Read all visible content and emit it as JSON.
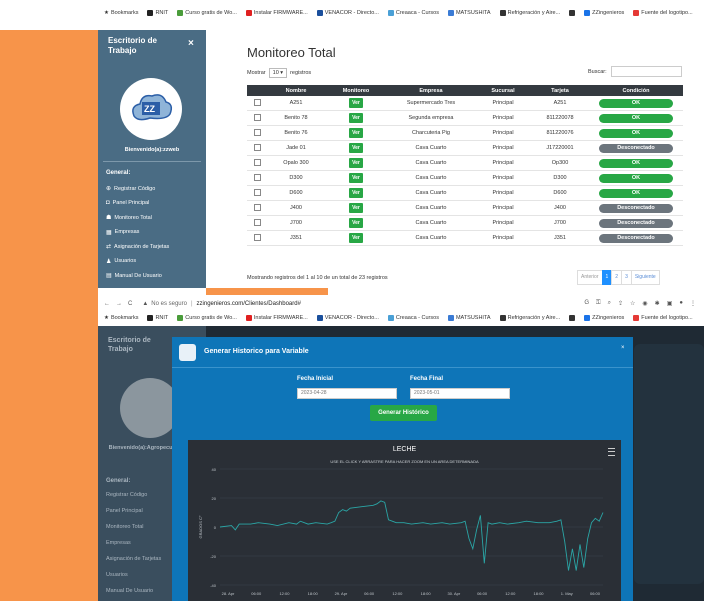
{
  "bookmarks": [
    {
      "label": "Bookmarks",
      "color": "#888888"
    },
    {
      "label": "RNIT",
      "color": "#222222"
    },
    {
      "label": "Curso gratis de Wo...",
      "color": "#4a9c3a"
    },
    {
      "label": "Instalar FIRMWARE...",
      "color": "#e02020"
    },
    {
      "label": "VENACOR - Directo...",
      "color": "#1a4f9c"
    },
    {
      "label": "Creaaca - Cursos",
      "color": "#4aa0d6"
    },
    {
      "label": "MATSUSHITA",
      "color": "#3a7bd5"
    },
    {
      "label": "Refrigeración y Aire...",
      "color": "#333333"
    },
    {
      "label": "",
      "color": "#333333"
    },
    {
      "label": "ZZingenieros",
      "color": "#1a73e8"
    },
    {
      "label": "Fuente del logotipo...",
      "color": "#e53935"
    }
  ],
  "sidebar": {
    "title": "Escritorio de Trabajo",
    "close": "×",
    "welcome": "Bienvenido(a):zzweb",
    "section": "General:",
    "items": [
      {
        "icon": "⊕",
        "label": "Registrar Código"
      },
      {
        "icon": "◘",
        "label": "Panel Principal"
      },
      {
        "icon": "☗",
        "label": "Monitoreo Total"
      },
      {
        "icon": "▦",
        "label": "Empresas"
      },
      {
        "icon": "⇄",
        "label": "Asignación de Tarjetas"
      },
      {
        "icon": "♟",
        "label": "Usuarios"
      },
      {
        "icon": "▤",
        "label": "Manual De Usuario"
      }
    ]
  },
  "main": {
    "title": "Monitoreo Total",
    "show_label": "Mostrar",
    "show_value": "10",
    "records_label": "registros",
    "search_label": "Buscar:",
    "columns": [
      "",
      "Nombre",
      "Monitoreo",
      "Empresa",
      "Sucursal",
      "Tarjeta",
      "Condición"
    ],
    "ver_label": "Ver",
    "rows": [
      {
        "nombre": "A251",
        "empresa": "Supermercado Tres",
        "sucursal": "Principal",
        "tarjeta": "A251",
        "condicion": "OK",
        "status": "ok"
      },
      {
        "nombre": "Benito 78",
        "empresa": "Segunda empresa",
        "sucursal": "Principal",
        "tarjeta": "811220078",
        "condicion": "OK",
        "status": "ok"
      },
      {
        "nombre": "Benito 76",
        "empresa": "Charcuteria Pig",
        "sucursal": "Principal",
        "tarjeta": "811220076",
        "condicion": "OK",
        "status": "ok"
      },
      {
        "nombre": "Jade 01",
        "empresa": "Cava Cuarto",
        "sucursal": "Principal",
        "tarjeta": "J17220001",
        "condicion": "Desconectado",
        "status": "off"
      },
      {
        "nombre": "Opalo 300",
        "empresa": "Cava Cuarto",
        "sucursal": "Principal",
        "tarjeta": "Op300",
        "condicion": "OK",
        "status": "ok"
      },
      {
        "nombre": "D300",
        "empresa": "Cava Cuarto",
        "sucursal": "Principal",
        "tarjeta": "D300",
        "condicion": "OK",
        "status": "ok"
      },
      {
        "nombre": "D600",
        "empresa": "Cava Cuarto",
        "sucursal": "Principal",
        "tarjeta": "D600",
        "condicion": "OK",
        "status": "ok"
      },
      {
        "nombre": "J400",
        "empresa": "Cava Cuarto",
        "sucursal": "Principal",
        "tarjeta": "J400",
        "condicion": "Desconectado",
        "status": "off"
      },
      {
        "nombre": "J700",
        "empresa": "Cava Cuarto",
        "sucursal": "Principal",
        "tarjeta": "J700",
        "condicion": "Desconectado",
        "status": "off"
      },
      {
        "nombre": "J351",
        "empresa": "Cava Cuarto",
        "sucursal": "Principal",
        "tarjeta": "J351",
        "condicion": "Desconectado",
        "status": "off"
      }
    ],
    "showing": "Mostrando registros del 1 al 10 de un total de 23 registros",
    "pagination": {
      "prev": "Anterior",
      "pages": [
        "1",
        "2",
        "3"
      ],
      "next": "Siguiente"
    }
  },
  "nav": {
    "back": "←",
    "forward": "→",
    "reload": "C",
    "warning": "▲",
    "not_secure": "No es seguro",
    "url": "zzingenieros.com/Clientes/Dashboard#"
  },
  "dashboard_sidebar": {
    "title": "Escritorio de Trabajo",
    "welcome": "Bienvenido(a):Agropecuaria Edis",
    "section": "General:",
    "items": [
      "Registrar Código",
      "Panel Principal",
      "Monitoreo Total",
      "Empresas",
      "Asignación de Tarjetas",
      "Usuarios",
      "Manual De Usuario"
    ]
  },
  "modal": {
    "title": "Generar Historico para Variable",
    "close": "×",
    "start_label": "Fecha Inicial",
    "start_value": "2023-04-28",
    "end_label": "Fecha Final",
    "end_value": "2023-05-01",
    "button": "Generar Histórico"
  },
  "colors": {
    "ok": "#28a745",
    "off": "#6c757d",
    "sidebar": "#4a6c84",
    "modal": "#0e75b8",
    "accent": "#f7944a"
  },
  "chart_data": {
    "type": "line",
    "title": "LECHE",
    "subtitle": "USE EL CLICK Y ARRASTRE PARA HACER ZOOM EN UN AREA DETERMINADA",
    "ylabel": "GRADOS C°",
    "ylim": [
      -40,
      40
    ],
    "yticks": [
      40,
      20,
      0,
      -20,
      -40
    ],
    "xtick_labels": [
      "28. Apr",
      "06:00",
      "12:00",
      "18:00",
      "29. Apr",
      "06:00",
      "12:00",
      "18:00",
      "30. Apr",
      "06:00",
      "12:00",
      "18:00",
      "1. May",
      "06:00"
    ],
    "line_color": "#2aa6a6",
    "series": [
      {
        "x": [
          0,
          3,
          4,
          5,
          8,
          10,
          13,
          15,
          18,
          20,
          21,
          23,
          25,
          28,
          29,
          30,
          31,
          32,
          33,
          34,
          37,
          40,
          41,
          42,
          43,
          44,
          45,
          46,
          48,
          50,
          53,
          55,
          58,
          60,
          63,
          64,
          65,
          66,
          67,
          68,
          69,
          70,
          71,
          73,
          75,
          78,
          80,
          83,
          86,
          88,
          89,
          90,
          91,
          92,
          93,
          94,
          95,
          96,
          97,
          98,
          99,
          100
        ],
        "y": [
          0,
          1,
          -2,
          2,
          2,
          3,
          2,
          1,
          3,
          2,
          4,
          2,
          3,
          2,
          3,
          4,
          10,
          12,
          11,
          13,
          14,
          15,
          16,
          18,
          17,
          5,
          4,
          3,
          3,
          2,
          3,
          2,
          3,
          2,
          3,
          4,
          -8,
          -15,
          -2,
          8,
          -25,
          3,
          2,
          3,
          2,
          3,
          4,
          3,
          3,
          4,
          5,
          -10,
          -30,
          -15,
          -30,
          -12,
          -28,
          -8,
          3,
          6,
          4,
          10
        ]
      }
    ]
  }
}
